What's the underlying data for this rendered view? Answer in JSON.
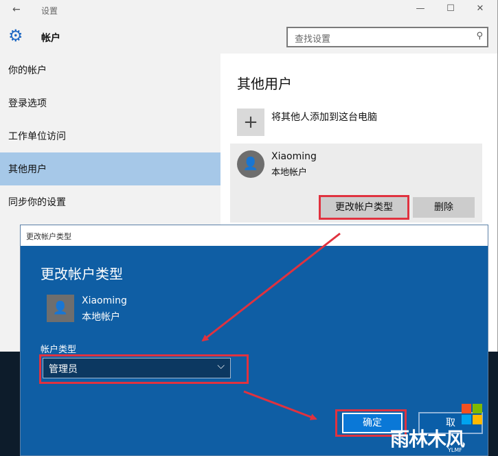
{
  "window": {
    "title": "设置",
    "back_icon": "←",
    "controls": {
      "minimize": "—",
      "maximize": "☐",
      "close": "✕"
    }
  },
  "header": {
    "icon": "gear-icon",
    "title": "帐户",
    "search_placeholder": "查找设置",
    "search_icon": "⚲"
  },
  "sidebar": {
    "items": [
      {
        "label": "你的帐户"
      },
      {
        "label": "登录选项"
      },
      {
        "label": "工作单位访问"
      },
      {
        "label": "其他用户",
        "selected": true
      },
      {
        "label": "同步你的设置"
      }
    ]
  },
  "main": {
    "title": "其他用户",
    "add_icon": "+",
    "add_label": "将其他人添加到这台电脑",
    "user": {
      "name": "Xiaoming",
      "type": "本地帐户"
    },
    "change_type_button": "更改帐户类型",
    "delete_button": "删除"
  },
  "dialog": {
    "window_title": "更改帐户类型",
    "title": "更改帐户类型",
    "user": {
      "name": "Xiaoming",
      "type": "本地帐户"
    },
    "account_type_label": "帐户类型",
    "account_type_value": "管理员",
    "chevron": "⌵",
    "ok_button": "确定",
    "cancel_button": "取"
  },
  "watermark": {
    "text": "雨林木风",
    "sub": "YLMF"
  },
  "colors": {
    "accent": "#1f68c3",
    "dialog_bg": "#0f5ea4",
    "selected_nav": "#a6c8e8",
    "highlight": "#e0323f"
  }
}
